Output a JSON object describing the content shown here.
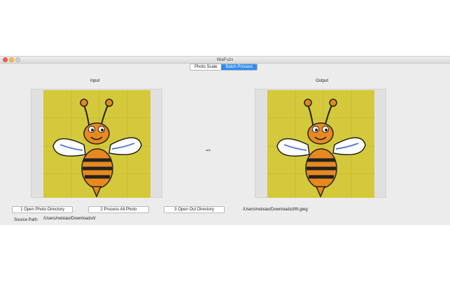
{
  "window": {
    "title": "WaiFu2x"
  },
  "tabs": [
    {
      "label": "Photo Scale",
      "active": false
    },
    {
      "label": "Batch Process",
      "active": true
    }
  ],
  "input": {
    "label": "Input"
  },
  "output": {
    "label": "Output"
  },
  "arrow": "=>",
  "buttons": {
    "open_photo_dir": "1 Open Photo Directory",
    "process_all": "2 Process All Photo",
    "open_out_dir": "3 Open Out Directory"
  },
  "output_file": "/Users/netxiao/Downloads/t/th.jpeg",
  "source_path": {
    "label": "Source Path:",
    "value": "/Users/netxiao/Downloads/t/"
  },
  "colors": {
    "accent": "#2f8cf0",
    "image_bg": "#d4c93a"
  }
}
